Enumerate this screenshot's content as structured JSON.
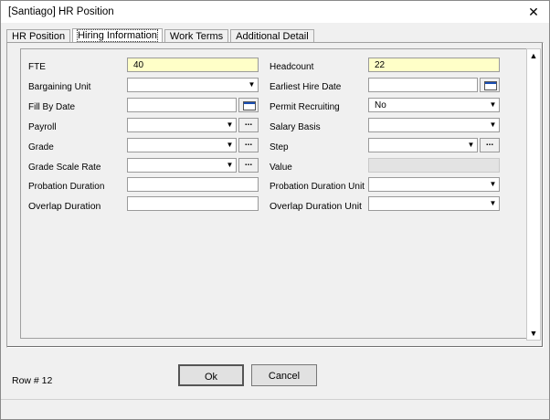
{
  "window": {
    "title": "[Santiago] HR Position",
    "close_glyph": "✕"
  },
  "tabs": [
    {
      "label": "HR Position"
    },
    {
      "label": "Hiring Information",
      "active": true
    },
    {
      "label": "Work Terms"
    },
    {
      "label": "Additional Detail"
    }
  ],
  "form": {
    "fte": {
      "label": "FTE",
      "value": "40"
    },
    "bargaining_unit": {
      "label": "Bargaining Unit",
      "value": ""
    },
    "fill_by_date": {
      "label": "Fill By Date",
      "value": ""
    },
    "payroll": {
      "label": "Payroll",
      "value": ""
    },
    "grade": {
      "label": "Grade",
      "value": ""
    },
    "grade_scale_rate": {
      "label": "Grade Scale Rate",
      "value": ""
    },
    "probation_duration": {
      "label": "Probation Duration",
      "value": ""
    },
    "overlap_duration": {
      "label": "Overlap Duration",
      "value": ""
    },
    "headcount": {
      "label": "Headcount",
      "value": "22"
    },
    "earliest_hire_date": {
      "label": "Earliest Hire Date",
      "value": ""
    },
    "permit_recruiting": {
      "label": "Permit Recruiting",
      "value": "No"
    },
    "salary_basis": {
      "label": "Salary Basis",
      "value": ""
    },
    "step": {
      "label": "Step",
      "value": ""
    },
    "value": {
      "label": "Value",
      "value": ""
    },
    "probation_duration_unit": {
      "label": "Probation Duration Unit",
      "value": ""
    },
    "overlap_duration_unit": {
      "label": "Overlap Duration Unit",
      "value": ""
    },
    "dropdown_glyph": "▼",
    "dots_glyph": "...",
    "scroll_up_glyph": "▲",
    "scroll_down_glyph": "▼"
  },
  "footer": {
    "row_number": "Row # 12",
    "ok_label": "Ok",
    "cancel_label": "Cancel"
  },
  "colors": {
    "required_field": "#ffffc8",
    "disabled_field": "#e3e3e3"
  }
}
